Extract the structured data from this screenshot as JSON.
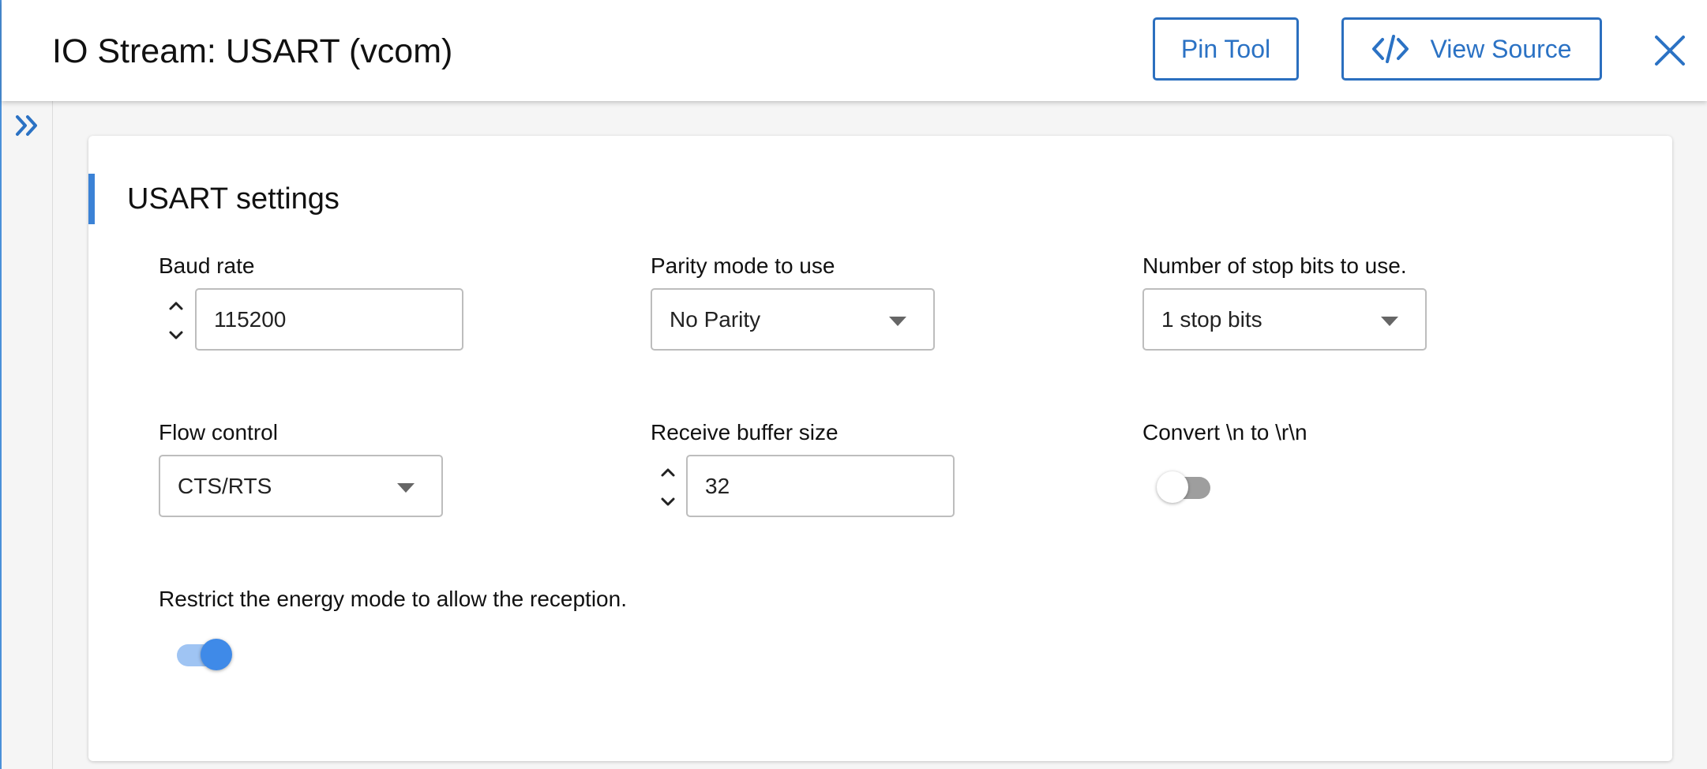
{
  "header": {
    "title": "IO Stream: USART (vcom)",
    "pin_tool_label": "Pin Tool",
    "view_source_label": "View Source",
    "accent_color": "#2b72c4"
  },
  "card": {
    "section_title": "USART settings",
    "fields": {
      "baud_rate": {
        "label": "Baud rate",
        "value": "115200"
      },
      "parity_mode": {
        "label": "Parity mode to use",
        "value": "No Parity"
      },
      "stop_bits": {
        "label": "Number of stop bits to use.",
        "value": "1 stop bits"
      },
      "flow_control": {
        "label": "Flow control",
        "value": "CTS/RTS"
      },
      "receive_buffer": {
        "label": "Receive buffer size",
        "value": "32"
      },
      "convert_newline": {
        "label": "Convert \\n to \\r\\n",
        "enabled": false
      },
      "restrict_energy": {
        "label": "Restrict the energy mode to allow the reception.",
        "enabled": true
      }
    }
  },
  "icons": {
    "close": "close-icon",
    "expand": "chevron-double-right-icon",
    "code": "code-icon",
    "step_up": "chevron-up-icon",
    "step_down": "chevron-down-icon",
    "dropdown": "caret-down-icon"
  }
}
